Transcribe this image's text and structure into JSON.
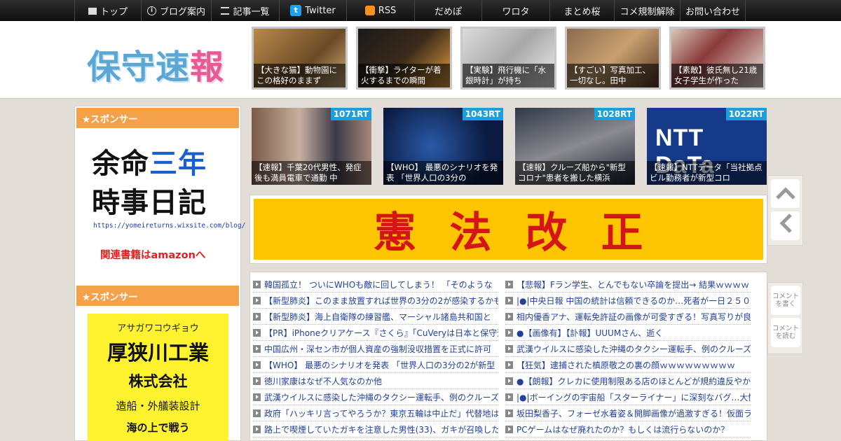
{
  "nav": {
    "items": [
      {
        "label": "トップ",
        "icon": "home-icon"
      },
      {
        "label": "ブログ案内",
        "icon": "info-icon"
      },
      {
        "label": "記事一覧",
        "icon": "list-icon"
      },
      {
        "label": "Twitter",
        "icon": "twitter-icon"
      },
      {
        "label": "RSS",
        "icon": "rss-icon"
      },
      {
        "label": "だめぽ",
        "icon": ""
      },
      {
        "label": "ワロタ",
        "icon": ""
      },
      {
        "label": "まとめ桜",
        "icon": ""
      },
      {
        "label": "コメ規制解除",
        "icon": ""
      },
      {
        "label": "お問い合わせ",
        "icon": ""
      }
    ]
  },
  "header": {
    "logo_part1": "保守",
    "logo_part2": "速",
    "logo_part3": "報",
    "thumbs": [
      {
        "caption": "【大きな猫】動物園にこの格好のままず"
      },
      {
        "caption": "【衝撃】ライターが着火するまでの瞬間"
      },
      {
        "caption": "【実験】飛行機に「水銀時計」が持ち"
      },
      {
        "caption": "【すごい】写真加工、一切なし。田中"
      },
      {
        "caption": "【素敵】彼氏無し21歳女子学生が作った"
      }
    ]
  },
  "sidebar": {
    "sponsor1_title": "★スポンサー",
    "ad1_line1a": "余命",
    "ad1_line1b": "三年",
    "ad1_line2": "時事日記",
    "ad1_url": "https://yomeireturns.wixsite.com/blog/",
    "ad1_amazon": "関連書籍はamazonへ",
    "sponsor2_title": "★スポンサー",
    "ad2_kana": "アサガワコウギョウ",
    "ad2_name": "厚狭川工業",
    "ad2_corp": "株式会社",
    "ad2_desc": "造船・外艤装設計",
    "ad2_more": "海の上で戦う"
  },
  "rt_thumbs": [
    {
      "badge": "1071RT",
      "caption": "【速報】千葉20代男性、発症後も満員電車で通勤 中"
    },
    {
      "badge": "1043RT",
      "caption": "【WHO】 最悪のシナリオを発表 「世界人口の3分の"
    },
    {
      "badge": "1028RT",
      "caption": "【速報】クルーズ船から\"新型コロナ\"患者を搬した横浜"
    },
    {
      "badge": "1022RT",
      "caption": "【速報】NTTデータ「当社拠点ビル勤務者が新型コロ"
    }
  ],
  "rt_logo_text": "NTT DaTa",
  "banner_text": "憲法改正",
  "articles_left": [
    "韓国孤立！ ついにWHOも敵に回してしまう！ 「そのような",
    "【新型肺炎】このまま放置すれば世界の3分の2が感染するかも",
    "【新型肺炎】海上自衛隊の練習艦、マーシャル諸島共和国と",
    "【PR】iPhoneクリアケース『さくら』「CuVeryは日本と保守速",
    "中国広州・深セン市が個人資産の強制没収措置を正式に許可",
    "【WHO】 最悪のシナリオを発表 「世界人口の3分の2が新型",
    "徳川家康はなぜ不人気なのか他",
    "武漢ウイルスに感染した沖縄のタクシー運転手、例のクルーズ",
    "政府「ハッキリ言ってやろうか？東京五輪は中止だ」代替地は",
    "路上で喫煙していたガキを注意した男性(33)、ガキが召喚した父"
  ],
  "articles_right": [
    "【悲報】Fラン学生、とんでもない卒論を提出→ 結果ｗｗｗｗ",
    "|●|中央日報 中国の統計は信頼できるのか…死者が一日２５０",
    "相内優香アナ、運転免許証の画像が可愛すぎる！写真写りが良",
    "●【画像有】【訃報】UUUMさん、逝く",
    "武漢ウイルスに感染した沖縄のタクシー運転手、例のクルーズ",
    "【狂気】逮捕された槙原敬之の裏の顔ｗｗｗｗｗｗｗｗｗ",
    "●【朗報】クレカに使用制限ある店のほとんどが規約違反やか",
    "|●|ボーイングの宇宙船「スターライナー」に深刻なバグ…大惨",
    "坂田梨香子、フォーゼ水着姿＆開脚画像が過激すぎる！仮面ラ",
    "PCゲームはなぜ廃れたのか？もしくは流行らないのか？"
  ],
  "float": {
    "up_icon": "^",
    "back_icon": "<",
    "comment_write": "コメント\nを書く",
    "comment_read": "コメント\nを読む"
  }
}
